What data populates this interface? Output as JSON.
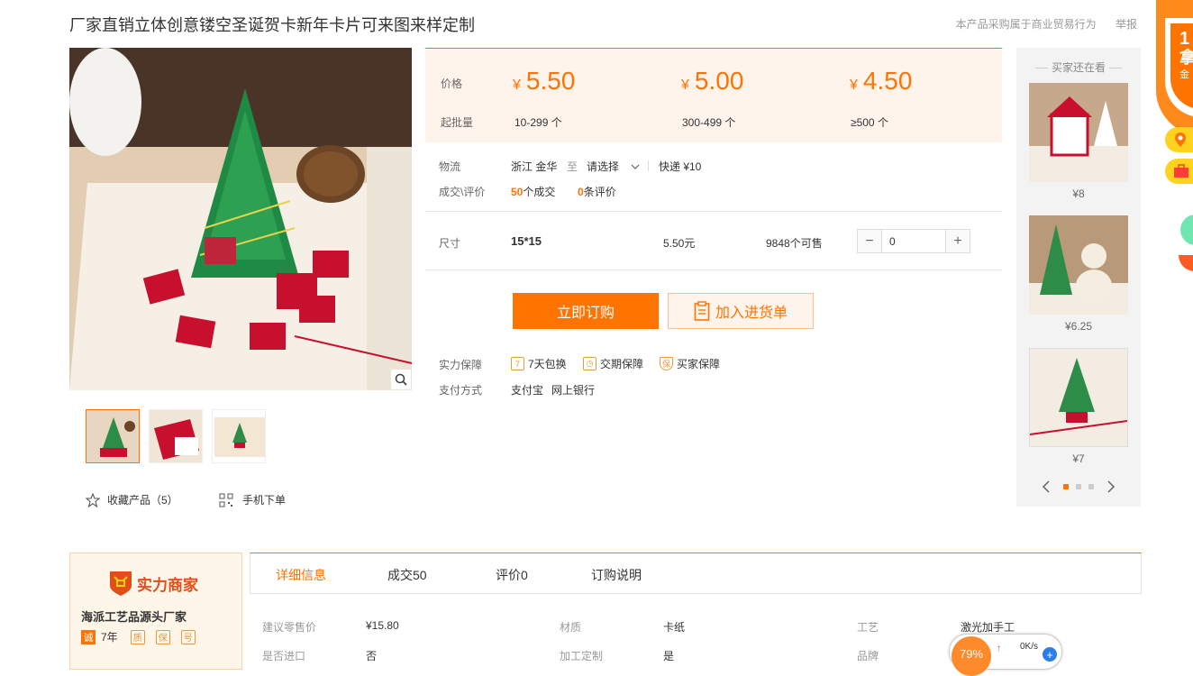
{
  "title": "厂家直销立体创意镂空圣诞贺卡新年卡片可来图来样定制",
  "top_links": {
    "trade_notice": "本产品采购属于商业贸易行为",
    "report": "举报"
  },
  "price": {
    "price_label": "价格",
    "moq_label": "起批量",
    "tiers": [
      {
        "currency": "¥",
        "price": "5.50",
        "qty": "10-299 个"
      },
      {
        "currency": "¥",
        "price": "5.00",
        "qty": "300-499 个"
      },
      {
        "currency": "¥",
        "price": "4.50",
        "qty": "≥500 个"
      }
    ]
  },
  "logistics": {
    "label": "物流",
    "from": "浙江 金华",
    "to_word": "至",
    "dest": "请选择",
    "express": "快递 ¥10"
  },
  "deals": {
    "label": "成交\\评价",
    "deal_count": "50",
    "deal_unit": "个成交",
    "review_count": "0",
    "review_unit": "条评价"
  },
  "sku": {
    "label": "尺寸",
    "size": "15*15",
    "price": "5.50元",
    "stock": "9848个可售",
    "qty": "0"
  },
  "buttons": {
    "buy": "立即订购",
    "cart": "加入进货单"
  },
  "guarantee": {
    "label": "实力保障",
    "items": [
      {
        "icon": "seven-day-icon",
        "text": "7天包换"
      },
      {
        "icon": "calendar-icon",
        "text": "交期保障"
      },
      {
        "icon": "shield-icon",
        "text": "买家保障"
      }
    ]
  },
  "payment": {
    "label": "支付方式",
    "methods": [
      "支付宝",
      "网上银行"
    ]
  },
  "favorites": {
    "label": "收藏产品（5）"
  },
  "mobile_order": {
    "label": "手机下单"
  },
  "recommend": {
    "title": "买家还在看",
    "items": [
      {
        "price": "¥8"
      },
      {
        "price": "¥6.25"
      },
      {
        "price": "¥7"
      }
    ]
  },
  "shop": {
    "badge": "实力商家",
    "name": "海派工艺品源头厂家",
    "years": "7年",
    "badge_chars": [
      "诚",
      "质",
      "保",
      "号"
    ]
  },
  "tabs": [
    "详细信息",
    "成交50",
    "评价0",
    "订购说明"
  ],
  "attributes": [
    {
      "key": "建议零售价",
      "value": "¥15.80"
    },
    {
      "key": "材质",
      "value": "卡纸"
    },
    {
      "key": "工艺",
      "value": "激光加手工"
    },
    {
      "key": "是否进口",
      "value": "否"
    },
    {
      "key": "加工定制",
      "value": "是"
    },
    {
      "key": "品牌",
      "value": ""
    }
  ],
  "speed_widget": {
    "percent": "79%",
    "rate": "0K/s"
  },
  "float_badge": {
    "text1": "1",
    "text2": "拿",
    "text3": "金"
  },
  "colors": {
    "accent": "#ff7300",
    "price_bg": "#fff4ec"
  }
}
